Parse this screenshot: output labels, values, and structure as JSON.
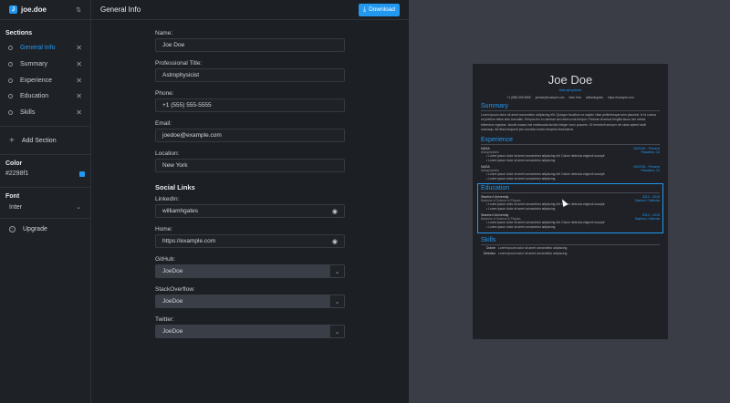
{
  "brand": {
    "name": "joe.doe",
    "logo": "J"
  },
  "sidebar": {
    "sections_title": "Sections",
    "sections": [
      {
        "label": "General Info",
        "active": true
      },
      {
        "label": "Summary",
        "active": false
      },
      {
        "label": "Experience",
        "active": false
      },
      {
        "label": "Education",
        "active": false
      },
      {
        "label": "Skills",
        "active": false
      }
    ],
    "add_section": "Add Section",
    "color_title": "Color",
    "color_value": "#2298f1",
    "font_title": "Font",
    "font_value": "Inter",
    "upgrade": "Upgrade"
  },
  "topbar": {
    "title": "General Info",
    "download": "Download"
  },
  "form": {
    "name": {
      "label": "Name:",
      "value": "Joe Doe"
    },
    "title": {
      "label": "Professional Title:",
      "value": "Astrophysicist"
    },
    "phone": {
      "label": "Phone:",
      "value": "+1 (555) 555-5555"
    },
    "email": {
      "label": "Email:",
      "value": "joedoe@example.com"
    },
    "location": {
      "label": "Location:",
      "value": "New York"
    },
    "social_heading": "Social Links",
    "linkedin": {
      "label": "LinkedIn:",
      "value": "williamhgates"
    },
    "home": {
      "label": "Home:",
      "value": "https://example.com"
    },
    "github": {
      "label": "GitHub:",
      "value": "JoeDoe"
    },
    "stackoverflow": {
      "label": "StackOverflow:",
      "value": "JoeDoe"
    },
    "twitter": {
      "label": "Twitter:",
      "value": "JoeDoe"
    }
  },
  "resume": {
    "name": "Joe Doe",
    "title": "Astrophysicist",
    "contact": [
      "+1 (555) 555-5555",
      "joedoe@example.com",
      "New York",
      "williamhgates",
      "https://example.com"
    ],
    "summary_h": "Summary",
    "summary": "Lorem ipsum dolor sit amet consectetur adipiscing elit. Quisque faucibus ex sapien vitae pellentesque sem placerat. In id cursus mi pretium tellus duis convallis. Tempus leo eu aenean sed diam urna tempor. Pulvinar vivamus fringilla lacus nec metus bibendum egestas. Iaculis massa nisl malesuada lacinia integer nunc posuere. Ut hendrerit semper vel class aptent taciti sociosqu. Ad litora torquent per conubia nostra inceptos himenaeos.",
    "experience_h": "Experience",
    "exp1": {
      "org": "NASA",
      "date": "05/2016 - Present",
      "role": "Astrophysicist",
      "loc": "Pasadena, CA",
      "b1": "Lorem ipsum dolor sit amet consectetur adipiscing elit. Dolore delectus eligendi suscipit",
      "b2": "Lorem ipsum dolor sit amet consectetur adipiscing"
    },
    "exp2": {
      "org": "NASA",
      "date": "05/2016 - Present",
      "role": "Astrophysicist",
      "loc": "Pasadena, CA",
      "b1": "Lorem ipsum dolor sit amet consectetur adipiscing elit. Dolore delectus eligendi suscipit",
      "b2": "Lorem ipsum dolor sit amet consectetur adipiscing"
    },
    "education_h": "Education",
    "edu1": {
      "org": "Stanford University",
      "date": "2014 - 2016",
      "deg": "Bachelor of Science in Physics",
      "loc": "Stanford, California",
      "b1": "Lorem ipsum dolor sit amet consectetur adipiscing elit. Dolore delectus eligendi suscipit",
      "b2": "Lorem ipsum dolor sit amet consectetur adipiscing"
    },
    "edu2": {
      "org": "Stanford University",
      "date": "2014 - 2016",
      "deg": "Bachelor of Science in Physics",
      "loc": "Stanford, California",
      "b1": "Lorem ipsum dolor sit amet consectetur adipiscing elit. Dolore delectus eligendi suscipit",
      "b2": "Lorem ipsum dolor sit amet consectetur adipiscing"
    },
    "skills_h": "Skills",
    "skills": [
      {
        "name": "Dolore",
        "desc": "Lorem ipsum dolor sit amet consectetur adipiscing"
      },
      {
        "name": "Delectus",
        "desc": "Lorem ipsum dolor sit amet consectetur adipiscing"
      }
    ]
  },
  "colors": {
    "accent": "#2298f1",
    "bg": "#1c1f24",
    "preview_bg": "#3a3d45"
  }
}
